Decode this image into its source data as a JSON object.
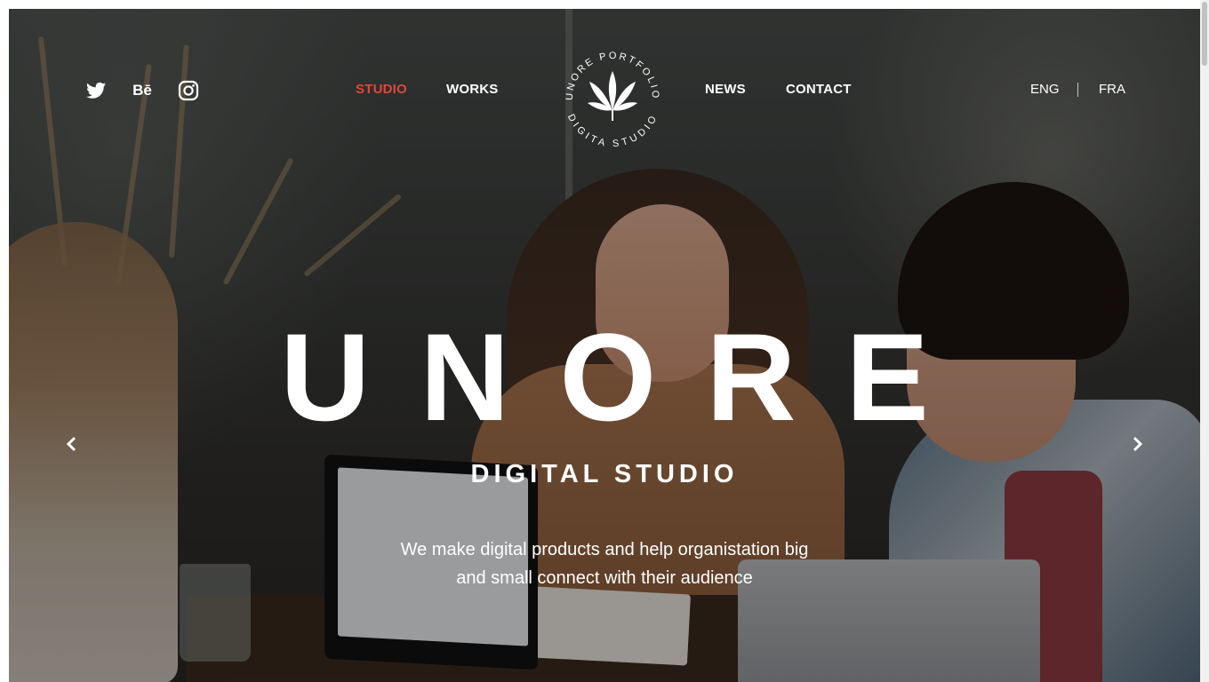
{
  "social": [
    {
      "name": "twitter-icon",
      "label": ""
    },
    {
      "name": "behance-icon",
      "label": "Bē"
    },
    {
      "name": "instagram-icon",
      "label": ""
    }
  ],
  "nav": {
    "studio": "STUDIO",
    "works": "WORKS",
    "news": "NEWS",
    "contact": "CONTACT",
    "active": "STUDIO"
  },
  "logo": {
    "ring_top": "UNORE PORTFOLIO",
    "ring_bottom": "DIGITA STUDIO",
    "icon": "cannabis-leaf-icon"
  },
  "lang": {
    "eng": "ENG",
    "fra": "FRA"
  },
  "hero": {
    "title": "UNORE",
    "subtitle": "DIGITAL STUDIO",
    "description_line1": "We make digital products and help organistation big",
    "description_line2": "and small connect with their audience"
  },
  "colors": {
    "accent": "#e0473a",
    "text": "#ffffff"
  }
}
